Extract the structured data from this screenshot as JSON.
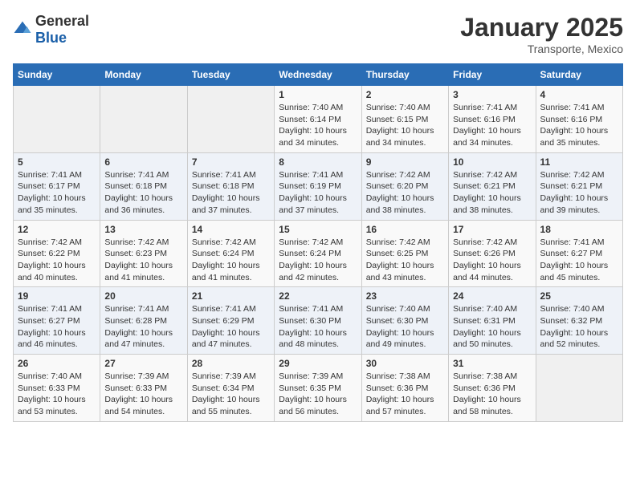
{
  "header": {
    "logo_general": "General",
    "logo_blue": "Blue",
    "month_year": "January 2025",
    "subtitle": "Transporte, Mexico"
  },
  "days_of_week": [
    "Sunday",
    "Monday",
    "Tuesday",
    "Wednesday",
    "Thursday",
    "Friday",
    "Saturday"
  ],
  "weeks": [
    [
      {
        "day": "",
        "info": ""
      },
      {
        "day": "",
        "info": ""
      },
      {
        "day": "",
        "info": ""
      },
      {
        "day": "1",
        "info": "Sunrise: 7:40 AM\nSunset: 6:14 PM\nDaylight: 10 hours and 34 minutes."
      },
      {
        "day": "2",
        "info": "Sunrise: 7:40 AM\nSunset: 6:15 PM\nDaylight: 10 hours and 34 minutes."
      },
      {
        "day": "3",
        "info": "Sunrise: 7:41 AM\nSunset: 6:16 PM\nDaylight: 10 hours and 34 minutes."
      },
      {
        "day": "4",
        "info": "Sunrise: 7:41 AM\nSunset: 6:16 PM\nDaylight: 10 hours and 35 minutes."
      }
    ],
    [
      {
        "day": "5",
        "info": "Sunrise: 7:41 AM\nSunset: 6:17 PM\nDaylight: 10 hours and 35 minutes."
      },
      {
        "day": "6",
        "info": "Sunrise: 7:41 AM\nSunset: 6:18 PM\nDaylight: 10 hours and 36 minutes."
      },
      {
        "day": "7",
        "info": "Sunrise: 7:41 AM\nSunset: 6:18 PM\nDaylight: 10 hours and 37 minutes."
      },
      {
        "day": "8",
        "info": "Sunrise: 7:41 AM\nSunset: 6:19 PM\nDaylight: 10 hours and 37 minutes."
      },
      {
        "day": "9",
        "info": "Sunrise: 7:42 AM\nSunset: 6:20 PM\nDaylight: 10 hours and 38 minutes."
      },
      {
        "day": "10",
        "info": "Sunrise: 7:42 AM\nSunset: 6:21 PM\nDaylight: 10 hours and 38 minutes."
      },
      {
        "day": "11",
        "info": "Sunrise: 7:42 AM\nSunset: 6:21 PM\nDaylight: 10 hours and 39 minutes."
      }
    ],
    [
      {
        "day": "12",
        "info": "Sunrise: 7:42 AM\nSunset: 6:22 PM\nDaylight: 10 hours and 40 minutes."
      },
      {
        "day": "13",
        "info": "Sunrise: 7:42 AM\nSunset: 6:23 PM\nDaylight: 10 hours and 41 minutes."
      },
      {
        "day": "14",
        "info": "Sunrise: 7:42 AM\nSunset: 6:24 PM\nDaylight: 10 hours and 41 minutes."
      },
      {
        "day": "15",
        "info": "Sunrise: 7:42 AM\nSunset: 6:24 PM\nDaylight: 10 hours and 42 minutes."
      },
      {
        "day": "16",
        "info": "Sunrise: 7:42 AM\nSunset: 6:25 PM\nDaylight: 10 hours and 43 minutes."
      },
      {
        "day": "17",
        "info": "Sunrise: 7:42 AM\nSunset: 6:26 PM\nDaylight: 10 hours and 44 minutes."
      },
      {
        "day": "18",
        "info": "Sunrise: 7:41 AM\nSunset: 6:27 PM\nDaylight: 10 hours and 45 minutes."
      }
    ],
    [
      {
        "day": "19",
        "info": "Sunrise: 7:41 AM\nSunset: 6:27 PM\nDaylight: 10 hours and 46 minutes."
      },
      {
        "day": "20",
        "info": "Sunrise: 7:41 AM\nSunset: 6:28 PM\nDaylight: 10 hours and 47 minutes."
      },
      {
        "day": "21",
        "info": "Sunrise: 7:41 AM\nSunset: 6:29 PM\nDaylight: 10 hours and 47 minutes."
      },
      {
        "day": "22",
        "info": "Sunrise: 7:41 AM\nSunset: 6:30 PM\nDaylight: 10 hours and 48 minutes."
      },
      {
        "day": "23",
        "info": "Sunrise: 7:40 AM\nSunset: 6:30 PM\nDaylight: 10 hours and 49 minutes."
      },
      {
        "day": "24",
        "info": "Sunrise: 7:40 AM\nSunset: 6:31 PM\nDaylight: 10 hours and 50 minutes."
      },
      {
        "day": "25",
        "info": "Sunrise: 7:40 AM\nSunset: 6:32 PM\nDaylight: 10 hours and 52 minutes."
      }
    ],
    [
      {
        "day": "26",
        "info": "Sunrise: 7:40 AM\nSunset: 6:33 PM\nDaylight: 10 hours and 53 minutes."
      },
      {
        "day": "27",
        "info": "Sunrise: 7:39 AM\nSunset: 6:33 PM\nDaylight: 10 hours and 54 minutes."
      },
      {
        "day": "28",
        "info": "Sunrise: 7:39 AM\nSunset: 6:34 PM\nDaylight: 10 hours and 55 minutes."
      },
      {
        "day": "29",
        "info": "Sunrise: 7:39 AM\nSunset: 6:35 PM\nDaylight: 10 hours and 56 minutes."
      },
      {
        "day": "30",
        "info": "Sunrise: 7:38 AM\nSunset: 6:36 PM\nDaylight: 10 hours and 57 minutes."
      },
      {
        "day": "31",
        "info": "Sunrise: 7:38 AM\nSunset: 6:36 PM\nDaylight: 10 hours and 58 minutes."
      },
      {
        "day": "",
        "info": ""
      }
    ]
  ]
}
